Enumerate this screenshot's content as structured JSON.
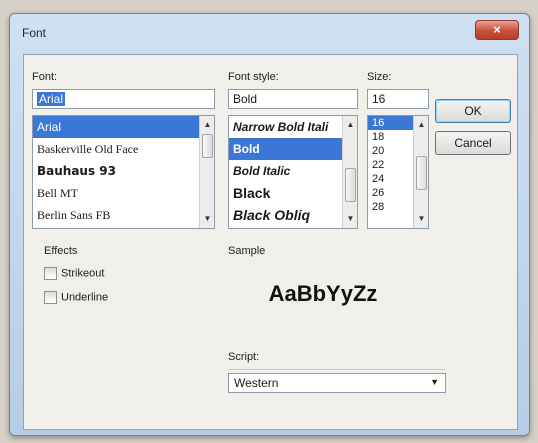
{
  "window": {
    "title": "Font",
    "close_glyph": "×"
  },
  "font": {
    "label": "Font:",
    "value": "Arial",
    "items": [
      {
        "label": "Arial",
        "selected": true
      },
      {
        "label": "Baskerville Old Face"
      },
      {
        "label": "Bauhaus 93"
      },
      {
        "label": "Bell MT"
      },
      {
        "label": "Berlin Sans FB"
      }
    ]
  },
  "style": {
    "label": "Font style:",
    "value": "Bold",
    "items": [
      {
        "label": "Narrow Bold Itali",
        "selected": false
      },
      {
        "label": "Bold",
        "selected": true
      },
      {
        "label": "Bold Italic"
      },
      {
        "label": "Black"
      },
      {
        "label": "Black Obliq"
      }
    ]
  },
  "size": {
    "label": "Size:",
    "value": "16",
    "items": [
      "16",
      "18",
      "20",
      "22",
      "24",
      "26",
      "28"
    ]
  },
  "buttons": {
    "ok": "OK",
    "cancel": "Cancel"
  },
  "effects": {
    "label": "Effects",
    "strikeout": {
      "label": "Strikeout",
      "checked": false
    },
    "underline": {
      "label": "Underline",
      "checked": false
    }
  },
  "sample": {
    "label": "Sample",
    "text": "AaBbYyZz"
  },
  "script": {
    "label": "Script:",
    "value": "Western"
  },
  "icons": {
    "scroll_up": "up-arrow-icon",
    "scroll_down": "down-arrow-icon",
    "dropdown": "chevron-down-icon"
  }
}
